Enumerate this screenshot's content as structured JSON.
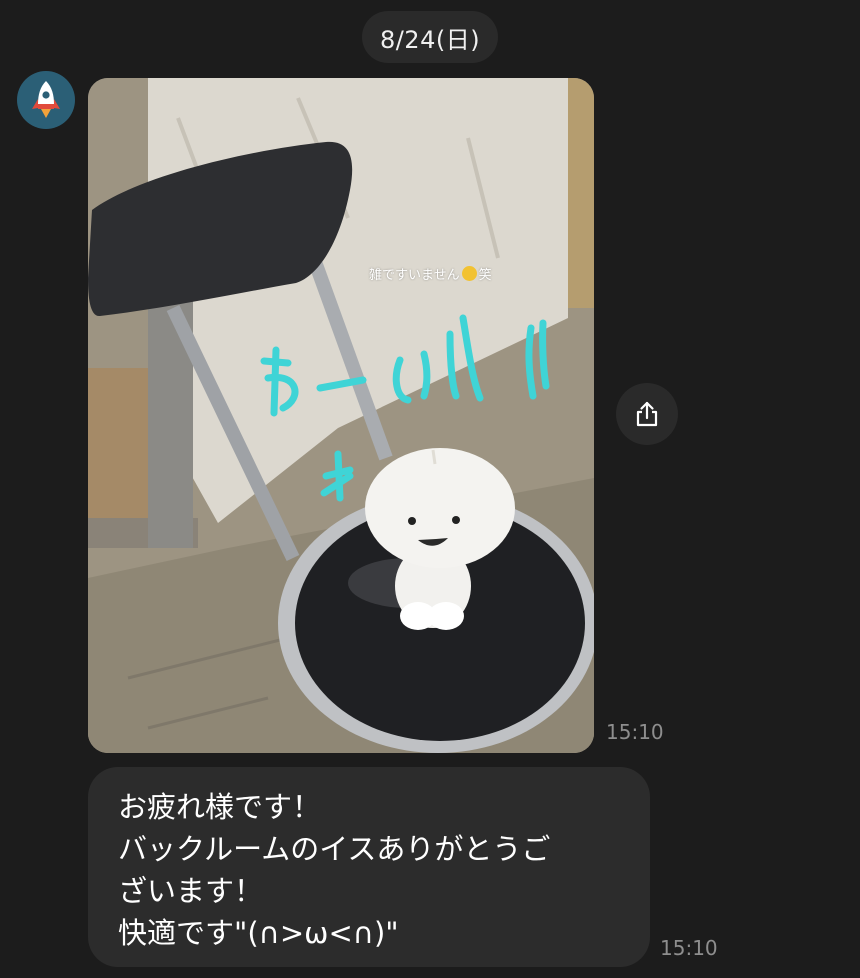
{
  "header": {
    "date_label": "8/24(日)"
  },
  "sender": {
    "avatar_icon": "rocket-icon",
    "avatar_color": "#2b5f76"
  },
  "messages": [
    {
      "type": "photo",
      "photo_caption_overlay": "雑ですいません",
      "photo_caption_suffix": "笑",
      "handwritten_overlay": "わーい!!",
      "time": "15:10"
    },
    {
      "type": "text",
      "lines": [
        "お疲れ様です！",
        "バックルームのイスありがとうご",
        "ざいます！",
        "快適です\"(∩>ω<∩)\""
      ],
      "time": "15:10"
    }
  ],
  "actions": {
    "share_icon": "share-icon"
  },
  "colors": {
    "background": "#1c1c1c",
    "bubble": "#2c2c2c",
    "timestamp": "#8e8e8e",
    "handwriting": "#3fd4d6"
  }
}
